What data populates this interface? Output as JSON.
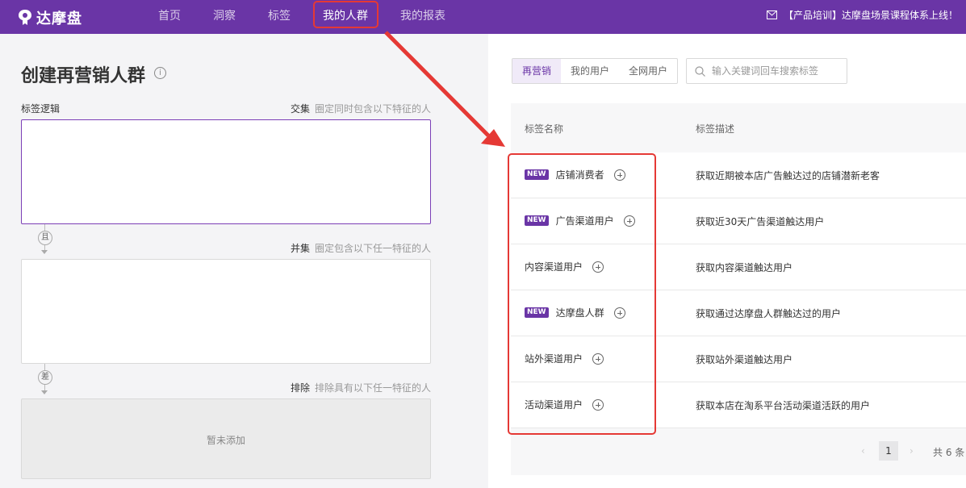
{
  "brand": {
    "name": "达摩盘"
  },
  "nav": {
    "items": [
      {
        "label": "首页"
      },
      {
        "label": "洞察"
      },
      {
        "label": "标签"
      },
      {
        "label": "我的人群"
      },
      {
        "label": "我的报表"
      }
    ],
    "notice": "【产品培训】达摩盘场景课程体系上线！"
  },
  "left": {
    "title": "创建再营销人群",
    "tag_logic_label": "标签逻辑",
    "intersection": {
      "label": "交集",
      "hint": "圈定同时包含以下特征的人"
    },
    "and_connector": "且",
    "union": {
      "label": "并集",
      "hint": "圈定包含以下任一特征的人"
    },
    "diff_connector": "差",
    "exclude": {
      "label": "排除",
      "hint": "排除具有以下任一特征的人"
    },
    "empty_text": "暂未添加"
  },
  "right": {
    "tabs": [
      {
        "label": "再营销",
        "active": true
      },
      {
        "label": "我的用户",
        "active": false
      },
      {
        "label": "全网用户",
        "active": false
      }
    ],
    "search_placeholder": "输入关键词回车搜索标签",
    "table": {
      "headers": {
        "name": "标签名称",
        "desc": "标签描述"
      },
      "rows": [
        {
          "badge": "NEW",
          "name": "店铺消费者",
          "desc": "获取近期被本店广告触达过的店铺潜新老客"
        },
        {
          "badge": "NEW",
          "name": "广告渠道用户",
          "desc": "获取近30天广告渠道触达用户"
        },
        {
          "badge": "",
          "name": "内容渠道用户",
          "desc": "获取内容渠道触达用户"
        },
        {
          "badge": "NEW",
          "name": "达摩盘人群",
          "desc": "获取通过达摩盘人群触达过的用户"
        },
        {
          "badge": "",
          "name": "站外渠道用户",
          "desc": "获取站外渠道触达用户"
        },
        {
          "badge": "",
          "name": "活动渠道用户",
          "desc": "获取本店在淘系平台活动渠道活跃的用户"
        }
      ]
    },
    "pagination": {
      "prev": "‹",
      "current": "1",
      "next": "›",
      "total": "共 6 条"
    }
  },
  "colors": {
    "brand": "#6a35a6",
    "highlight": "#e53935"
  },
  "icons": [
    "logo-icon",
    "mail-icon",
    "info-icon",
    "search-icon",
    "plus-circle-icon"
  ]
}
